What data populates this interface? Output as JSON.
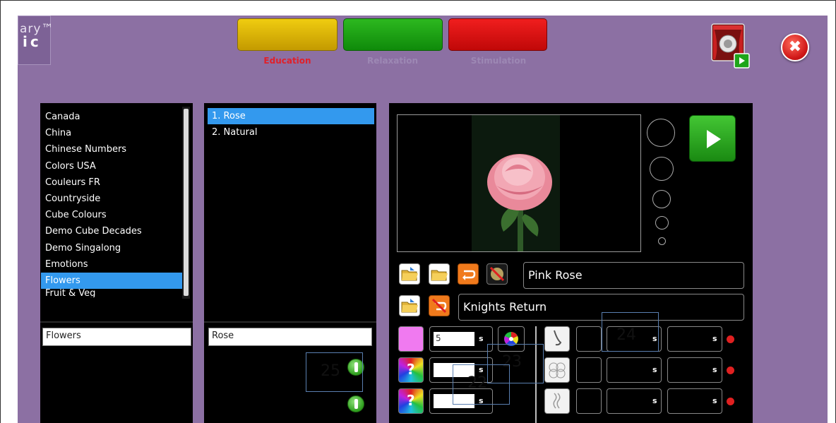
{
  "logo": {
    "line1": "ary™",
    "line2": "ic"
  },
  "modes": [
    {
      "label": "Education",
      "color": "#e0b800",
      "label_color": "#e0202a"
    },
    {
      "label": "Relaxation",
      "color": "#17a012",
      "label_color": "#9a84b2"
    },
    {
      "label": "Stimulation",
      "color": "#e01010",
      "label_color": "#9a84b2"
    }
  ],
  "close_glyph": "✖",
  "categories": [
    "Canada",
    "China",
    "Chinese Numbers",
    "Colors USA",
    "Couleurs FR",
    "Countryside",
    "Cube Colours",
    "Demo Cube Decades",
    "Demo Singalong",
    "Emotions",
    "Flowers",
    "Fruit & Veg"
  ],
  "selected_category_index": 10,
  "category_input": "Flowers",
  "items": [
    "1.  Rose",
    "2.  Natural"
  ],
  "selected_item_index": 0,
  "item_input": "Rose",
  "image_name": "Pink Rose",
  "music_name": "Knights Return",
  "duration_value": "5",
  "seconds_suffix": "s",
  "annotations": [
    "22",
    "23",
    "24",
    "25"
  ],
  "colors": {
    "stage": "#8c70a3",
    "select": "#3399ee",
    "swatch": "#f07af0",
    "red_dot": "#e02020"
  }
}
